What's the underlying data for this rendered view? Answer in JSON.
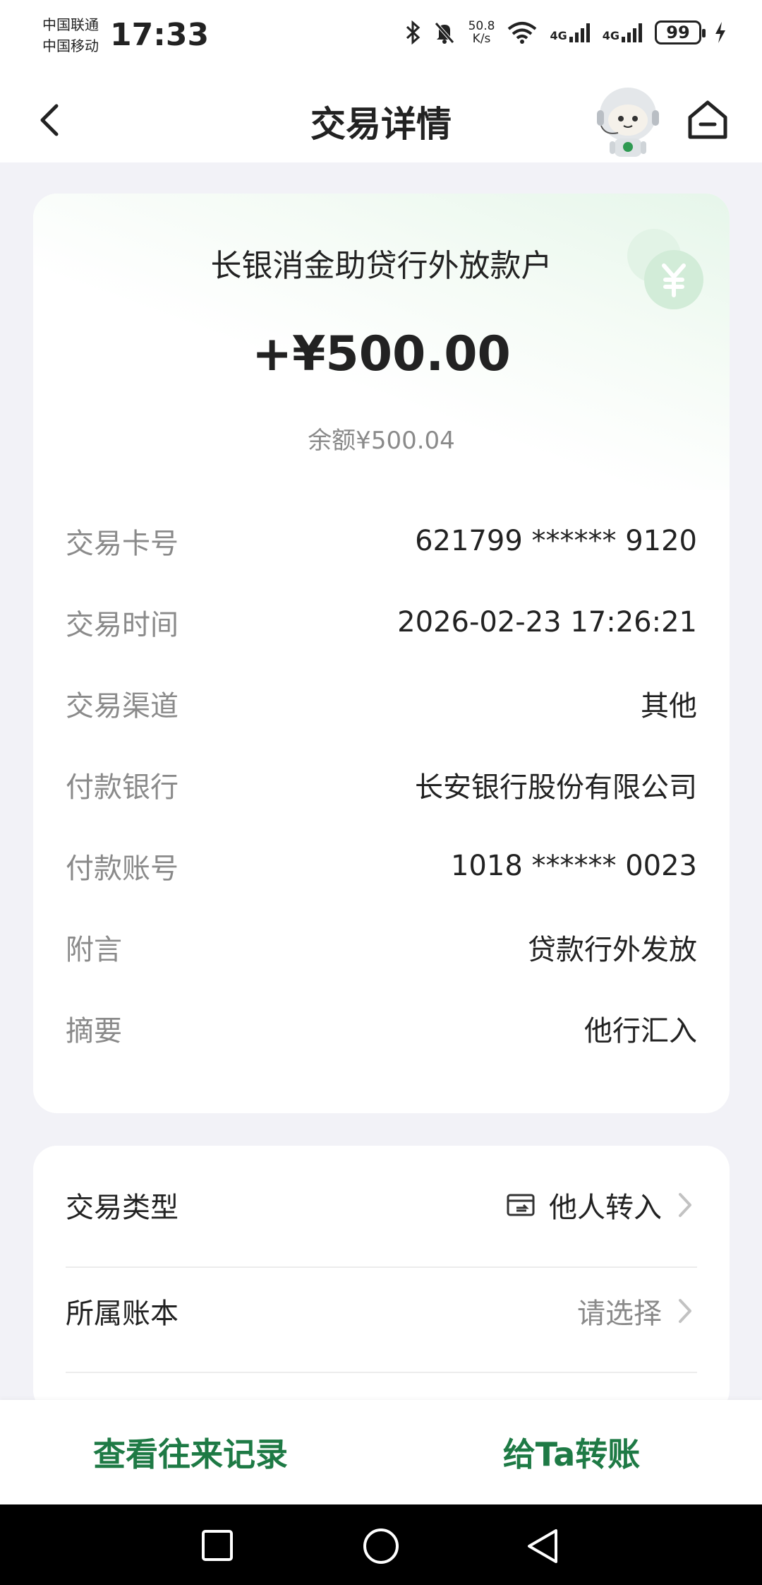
{
  "status_bar": {
    "carrier1": "中国联通",
    "carrier2": "中国移动",
    "time": "17:33",
    "net_speed_value": "50.8",
    "net_speed_unit": "K/s",
    "network1": "4G",
    "network2": "4G",
    "battery": "99"
  },
  "header": {
    "title": "交易详情"
  },
  "transaction": {
    "payee": "长银消金助贷行外放款户",
    "amount": "+¥500.00",
    "balance": "余额¥500.04",
    "details": [
      {
        "label": "交易卡号",
        "value": "621799 ****** 9120"
      },
      {
        "label": "交易时间",
        "value": "2026-02-23 17:26:21"
      },
      {
        "label": "交易渠道",
        "value": "其他"
      },
      {
        "label": "付款银行",
        "value": "长安银行股份有限公司"
      },
      {
        "label": "付款账号",
        "value": "1018 ****** 0023"
      },
      {
        "label": "附言",
        "value": "贷款行外发放"
      },
      {
        "label": "摘要",
        "value": "他行汇入"
      }
    ]
  },
  "options": {
    "type_label": "交易类型",
    "type_value": "他人转入",
    "ledger_label": "所属账本",
    "ledger_value": "请选择"
  },
  "bottom_actions": {
    "history": "查看往来记录",
    "transfer": "给Ta转账"
  },
  "colors": {
    "accent": "#1e7a45",
    "background": "#f2f2f7",
    "muted_text": "#8a8a8a"
  },
  "icons": {
    "back": "chevron-left-icon",
    "home": "home-icon",
    "mascot": "robot-assistant-icon",
    "coin": "yuan-coin-icon",
    "transfer_type": "card-transfer-icon",
    "chevron": "chevron-right-icon"
  }
}
